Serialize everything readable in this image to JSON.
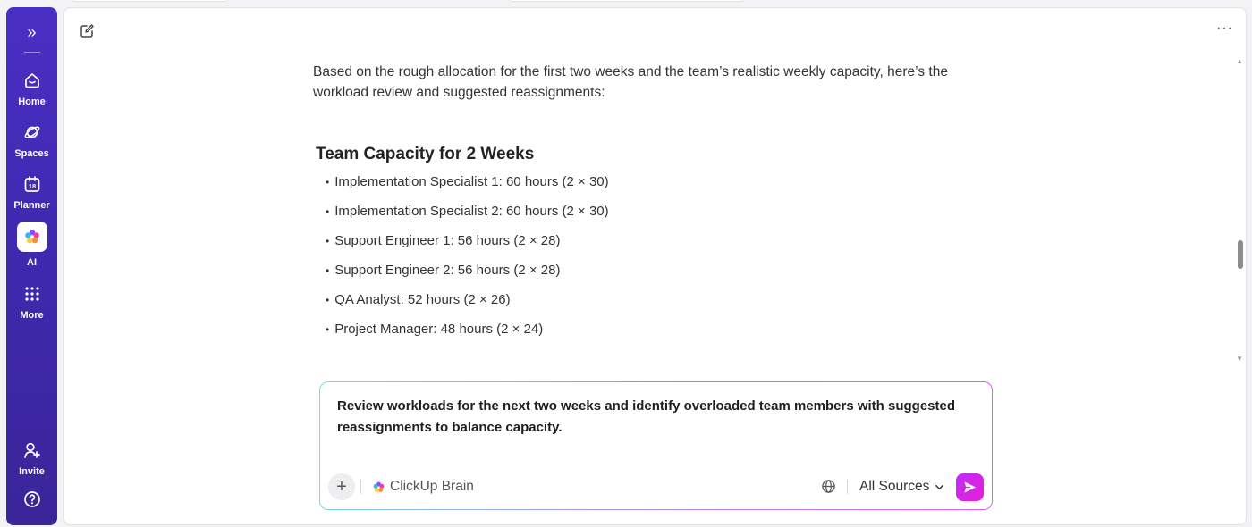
{
  "sidebar": {
    "items": [
      {
        "label": "Home",
        "icon": "home-icon"
      },
      {
        "label": "Spaces",
        "icon": "planet-icon"
      },
      {
        "label": "Planner",
        "icon": "calendar-icon",
        "calendar_day": "18"
      },
      {
        "label": "AI",
        "icon": "ai-flower-icon"
      },
      {
        "label": "More",
        "icon": "grid-icon"
      }
    ],
    "bottom": [
      {
        "label": "Invite",
        "icon": "add-user-icon"
      },
      {
        "icon": "help-icon"
      }
    ]
  },
  "main": {
    "more_icon": "ellipsis-icon",
    "edit_icon": "new-chat-icon",
    "intro": "Based on the rough allocation for the first two weeks and the team’s realistic weekly capacity, here’s the workload review and suggested reassignments:",
    "heading": "Team Capacity for 2 Weeks",
    "capacity": [
      "Implementation Specialist 1: 60 hours (2 × 30)",
      "Implementation Specialist 2: 60 hours (2 × 30)",
      "Support Engineer 1: 56 hours (2 × 28)",
      "Support Engineer 2: 56 hours (2 × 28)",
      "QA Analyst: 52 hours (2 × 26)",
      "Project Manager: 48 hours (2 × 24)"
    ]
  },
  "composer": {
    "prompt": "Review workloads for the next two weeks and identify overloaded team members with suggested reassignments to balance capacity.",
    "model": "ClickUp Brain",
    "sources": "All Sources"
  },
  "colors": {
    "sidebar": "#4a2fc4",
    "send_button": "#d224ea"
  }
}
